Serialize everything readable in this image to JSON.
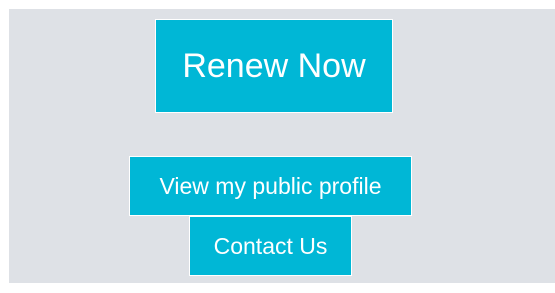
{
  "buttons": {
    "renew_label": "Renew Now",
    "profile_label": "View my public profile",
    "contact_label": "Contact Us"
  },
  "colors": {
    "panel_background": "#dee1e6",
    "button_background": "#00b7d6",
    "button_text": "#ffffff"
  }
}
